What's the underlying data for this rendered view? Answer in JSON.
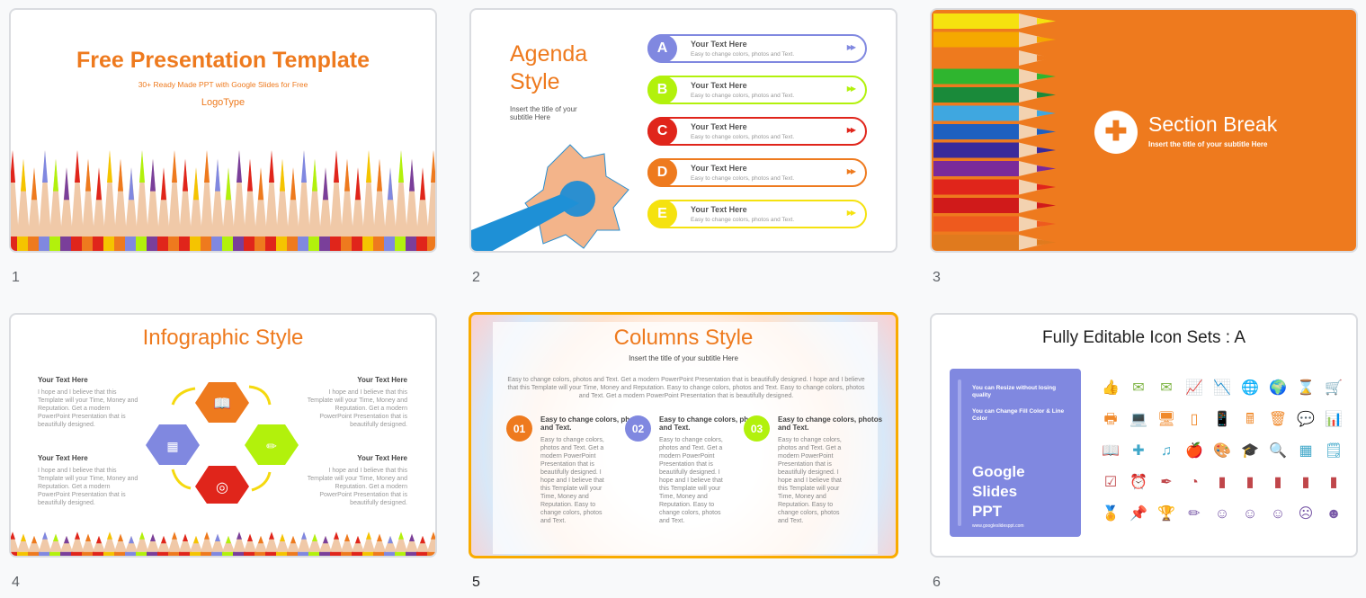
{
  "slides": [
    {
      "number": "1",
      "title": "Free Presentation Template",
      "subtitle": "30+ Ready Made PPT with Google Slides for Free",
      "logo": "LogoType"
    },
    {
      "number": "2",
      "title_line1": "Agenda",
      "title_line2": "Style",
      "subtitle": "Insert the title of your subtitle Here",
      "items": [
        {
          "letter": "A",
          "title": "Your Text  Here",
          "text": "Easy to change colors, photos and Text.",
          "color": "#8088e0"
        },
        {
          "letter": "B",
          "title": "Your Text  Here",
          "text": "Easy to change colors, photos and Text.",
          "color": "#b2f10c"
        },
        {
          "letter": "C",
          "title": "Your Text  Here",
          "text": "Easy to change colors, photos and Text.",
          "color": "#e0251b"
        },
        {
          "letter": "D",
          "title": "Your Text  Here",
          "text": "Easy to change colors, photos and Text.",
          "color": "#ee7a1e"
        },
        {
          "letter": "E",
          "title": "Your Text  Here",
          "text": "Easy to change colors, photos and Text.",
          "color": "#f5e20f"
        }
      ]
    },
    {
      "number": "3",
      "title": "Section Break",
      "subtitle": "Insert the title of your subtitle Here",
      "bg": "#ee7a1e"
    },
    {
      "number": "4",
      "title": "Infographic Style",
      "blocks": [
        {
          "title": "Your Text Here",
          "text": "I hope and I believe that this Template will your Time, Money and Reputation. Get a modern PowerPoint  Presentation that is beautifully designed."
        },
        {
          "title": "Your Text Here",
          "text": "I hope and I believe that this Template will your Time, Money and Reputation. Get a modern PowerPoint  Presentation that is beautifully designed."
        },
        {
          "title": "Your Text Here",
          "text": "I hope and I believe that this Template will your Time, Money and Reputation. Get a modern PowerPoint  Presentation that is beautifully designed."
        },
        {
          "title": "Your Text Here",
          "text": "I hope and I believe that this Template will your Time, Money and Reputation. Get a modern PowerPoint  Presentation that is beautifully designed."
        }
      ]
    },
    {
      "number": "5",
      "title": "Columns Style",
      "subtitle": "Insert the title of your subtitle Here",
      "intro": "Easy to change colors, photos and Text. Get a modern PowerPoint  Presentation that is beautifully designed. I hope and I believe that this Template will your Time, Money and Reputation. Easy to change colors, photos and Text. Easy to change colors, photos and Text. Get a modern PowerPoint  Presentation that is beautifully designed.",
      "columns": [
        {
          "num": "01",
          "color": "#ee7a1e",
          "title": "Easy to change colors, photos and Text.",
          "text": "Easy to change colors, photos and Text. Get a modern PowerPoint  Presentation that is beautifully designed. I hope and I believe that this Template will your Time, Money and Reputation. Easy to change colors, photos and Text."
        },
        {
          "num": "02",
          "color": "#8088e0",
          "title": "Easy to change colors, photos and Text.",
          "text": "Easy to change colors, photos and Text. Get a modern PowerPoint  Presentation that is beautifully designed. I hope and I believe that this Template will your Time, Money and Reputation. Easy to change colors, photos and Text."
        },
        {
          "num": "03",
          "color": "#b2f10c",
          "title": "Easy to change colors, photos and Text.",
          "text": "Easy to change colors, photos and Text. Get a modern PowerPoint  Presentation that is beautifully designed. I hope and I believe that this Template will your Time, Money and Reputation. Easy to change colors, photos and Text."
        }
      ]
    },
    {
      "number": "6",
      "title": "Fully Editable Icon Sets : A",
      "panel_note1": "You can Resize without losing quality",
      "panel_note2": "You can Change Fill Color & Line Color",
      "panel_title_1": "Google",
      "panel_title_2": "Slides",
      "panel_title_3": "PPT",
      "panel_url": "www.googleslidesppt.com",
      "icon_rows": [
        {
          "color": "#7cb342",
          "icons": [
            "👍",
            "✉",
            "✉",
            "📈",
            "📉",
            "🌐",
            "🌍",
            "⌛",
            "🛒"
          ],
          "names": [
            "thumbs-up",
            "mail",
            "open-mail",
            "chart-up",
            "chart-down",
            "globe",
            "desk-globe",
            "hourglass",
            "cart"
          ]
        },
        {
          "color": "#f08a2c",
          "icons": [
            "🖶",
            "💻",
            "🖥",
            "▯",
            "📱",
            "🖩",
            "🗑",
            "💬",
            "📊"
          ],
          "names": [
            "printer",
            "laptop",
            "monitor",
            "tablet",
            "phone",
            "calculator",
            "trash",
            "chat",
            "presentation"
          ]
        },
        {
          "color": "#3fa7c9",
          "icons": [
            "📖",
            "✚",
            "♫",
            "🍎",
            "🎨",
            "🎓",
            "🔍",
            "▦",
            "🗒"
          ],
          "names": [
            "book",
            "puzzle",
            "music",
            "apple",
            "palette",
            "graduation-cap",
            "magnifier",
            "calculator",
            "notepad"
          ]
        },
        {
          "color": "#c0464a",
          "icons": [
            "☑",
            "⏰",
            "✒",
            "◔",
            "▮",
            "▮",
            "▮",
            "▮",
            "▮"
          ],
          "names": [
            "checkbox",
            "alarm",
            "pen-nib",
            "pie-chart",
            "document",
            "document-a",
            "document-b",
            "document-c",
            "document-d"
          ]
        },
        {
          "color": "#7a5aa8",
          "icons": [
            "🏅",
            "📌",
            "🏆",
            "✏",
            "☺",
            "☺",
            "☺",
            "☹",
            "☻"
          ],
          "names": [
            "medal",
            "pushpin",
            "trophy",
            "pencil",
            "smile",
            "smirk",
            "happy",
            "sad",
            "laugh"
          ]
        }
      ]
    }
  ]
}
